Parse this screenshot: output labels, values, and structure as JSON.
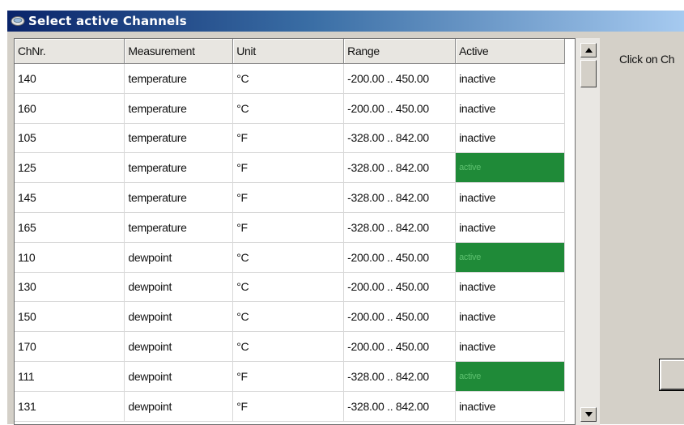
{
  "window": {
    "title": "Select active Channels",
    "title_icon": "disk-icon"
  },
  "table": {
    "columns": [
      "ChNr.",
      "Measurement",
      "Unit",
      "Range",
      "Active"
    ],
    "rows": [
      {
        "ch": "140",
        "measurement": "temperature",
        "unit": "°C",
        "range": "-200.00 .. 450.00",
        "active": "inactive"
      },
      {
        "ch": "160",
        "measurement": "temperature",
        "unit": "°C",
        "range": "-200.00 .. 450.00",
        "active": "inactive"
      },
      {
        "ch": "105",
        "measurement": "temperature",
        "unit": "°F",
        "range": "-328.00 .. 842.00",
        "active": "inactive"
      },
      {
        "ch": "125",
        "measurement": "temperature",
        "unit": "°F",
        "range": "-328.00 .. 842.00",
        "active": "active"
      },
      {
        "ch": "145",
        "measurement": "temperature",
        "unit": "°F",
        "range": "-328.00 .. 842.00",
        "active": "inactive"
      },
      {
        "ch": "165",
        "measurement": "temperature",
        "unit": "°F",
        "range": "-328.00 .. 842.00",
        "active": "inactive"
      },
      {
        "ch": "110",
        "measurement": "dewpoint",
        "unit": "°C",
        "range": "-200.00 .. 450.00",
        "active": "active"
      },
      {
        "ch": "130",
        "measurement": "dewpoint",
        "unit": "°C",
        "range": "-200.00 .. 450.00",
        "active": "inactive"
      },
      {
        "ch": "150",
        "measurement": "dewpoint",
        "unit": "°C",
        "range": "-200.00 .. 450.00",
        "active": "inactive"
      },
      {
        "ch": "170",
        "measurement": "dewpoint",
        "unit": "°C",
        "range": "-200.00 .. 450.00",
        "active": "inactive"
      },
      {
        "ch": "111",
        "measurement": "dewpoint",
        "unit": "°F",
        "range": "-328.00 .. 842.00",
        "active": "active"
      },
      {
        "ch": "131",
        "measurement": "dewpoint",
        "unit": "°F",
        "range": "-328.00 .. 842.00",
        "active": "inactive"
      }
    ]
  },
  "colors": {
    "active_bg": "#1f8a38",
    "active_text": "#5cc06e",
    "titlebar_start": "#0a246a"
  },
  "side_panel": {
    "hint": "Click on Ch"
  },
  "scrollbar": {
    "up_icon": "arrow-up-icon",
    "down_icon": "arrow-down-icon"
  }
}
